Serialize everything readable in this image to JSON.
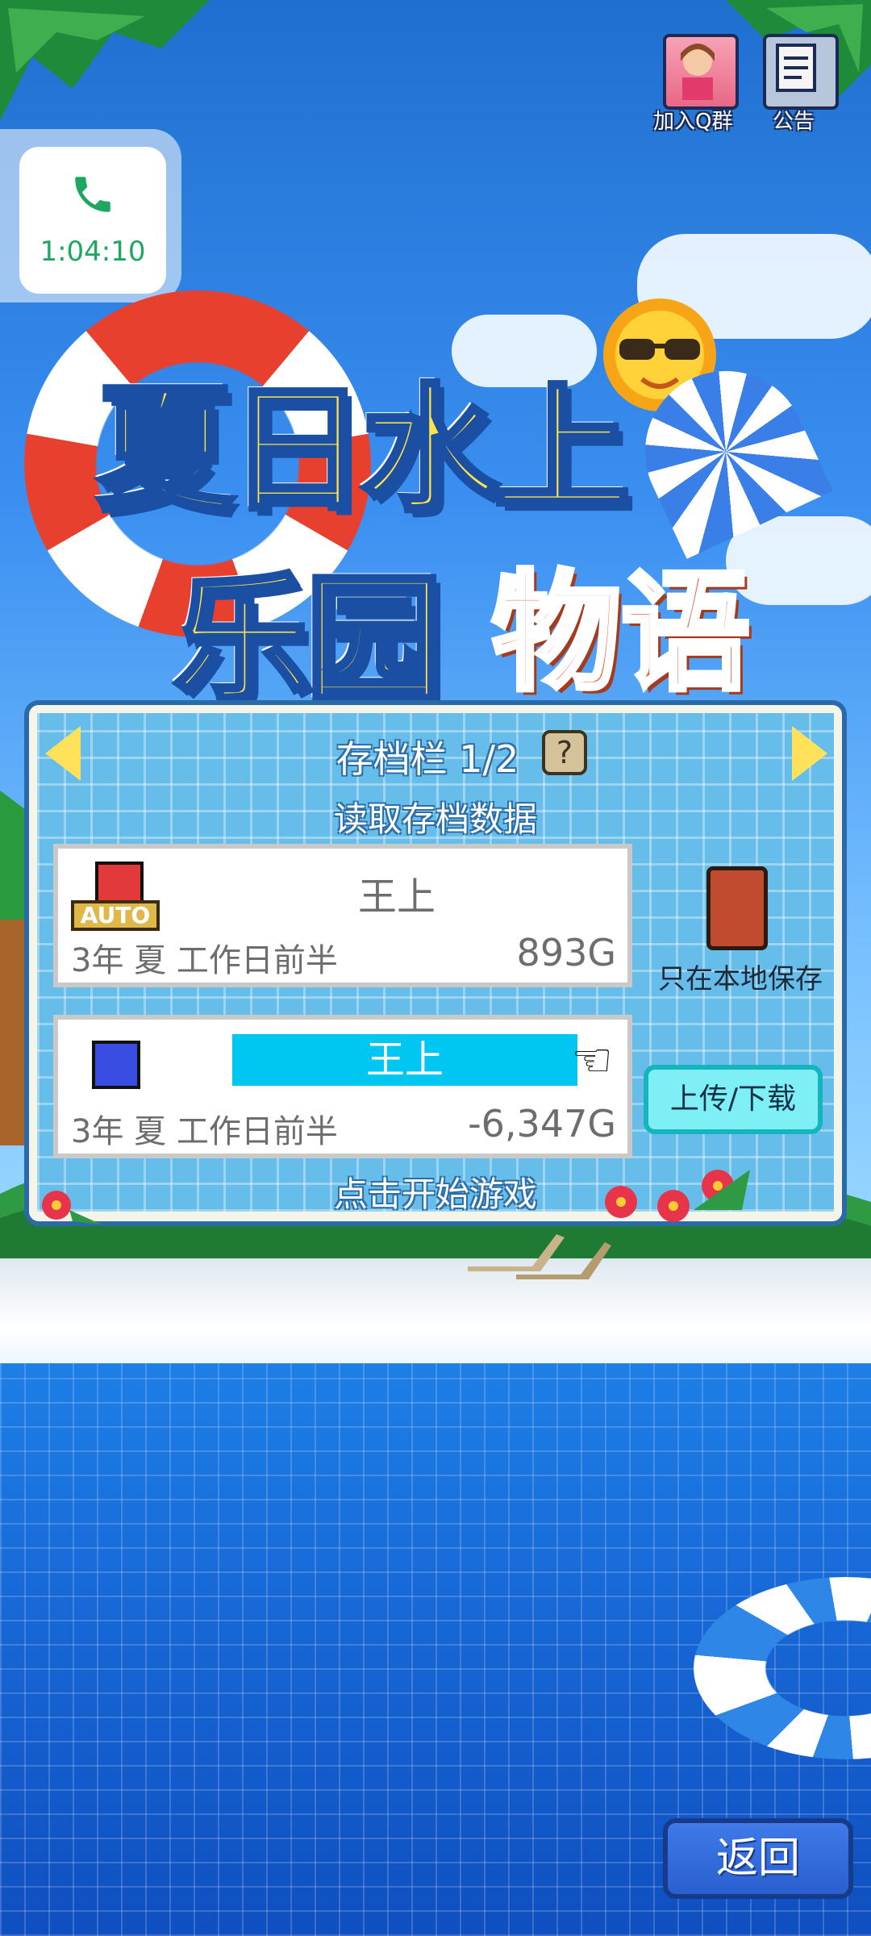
{
  "call": {
    "duration": "1:04:10"
  },
  "top_icons": {
    "qq_label": "加入Q群",
    "notice_label": "公告"
  },
  "logo": {
    "line1": "夏日水上",
    "line2": "乐园",
    "line3": "物语"
  },
  "save_panel": {
    "title": "存档栏 1/2",
    "help": "?",
    "load_label": "读取存档数据",
    "start_label": "点击开始游戏",
    "local_only_label": "只在本地保存",
    "upload_download": "上传/下载",
    "slots": [
      {
        "tag": "AUTO",
        "name": "王上",
        "date": "3年 夏 工作日前半",
        "money": "893G"
      },
      {
        "name": "王上",
        "date": "3年 夏 工作日前半",
        "money": "-6,347G"
      }
    ]
  },
  "back_button": "返回",
  "colors": {
    "accent": "#00c6f2",
    "call_green": "#1ea760",
    "panel_blue": "#67bde9"
  }
}
